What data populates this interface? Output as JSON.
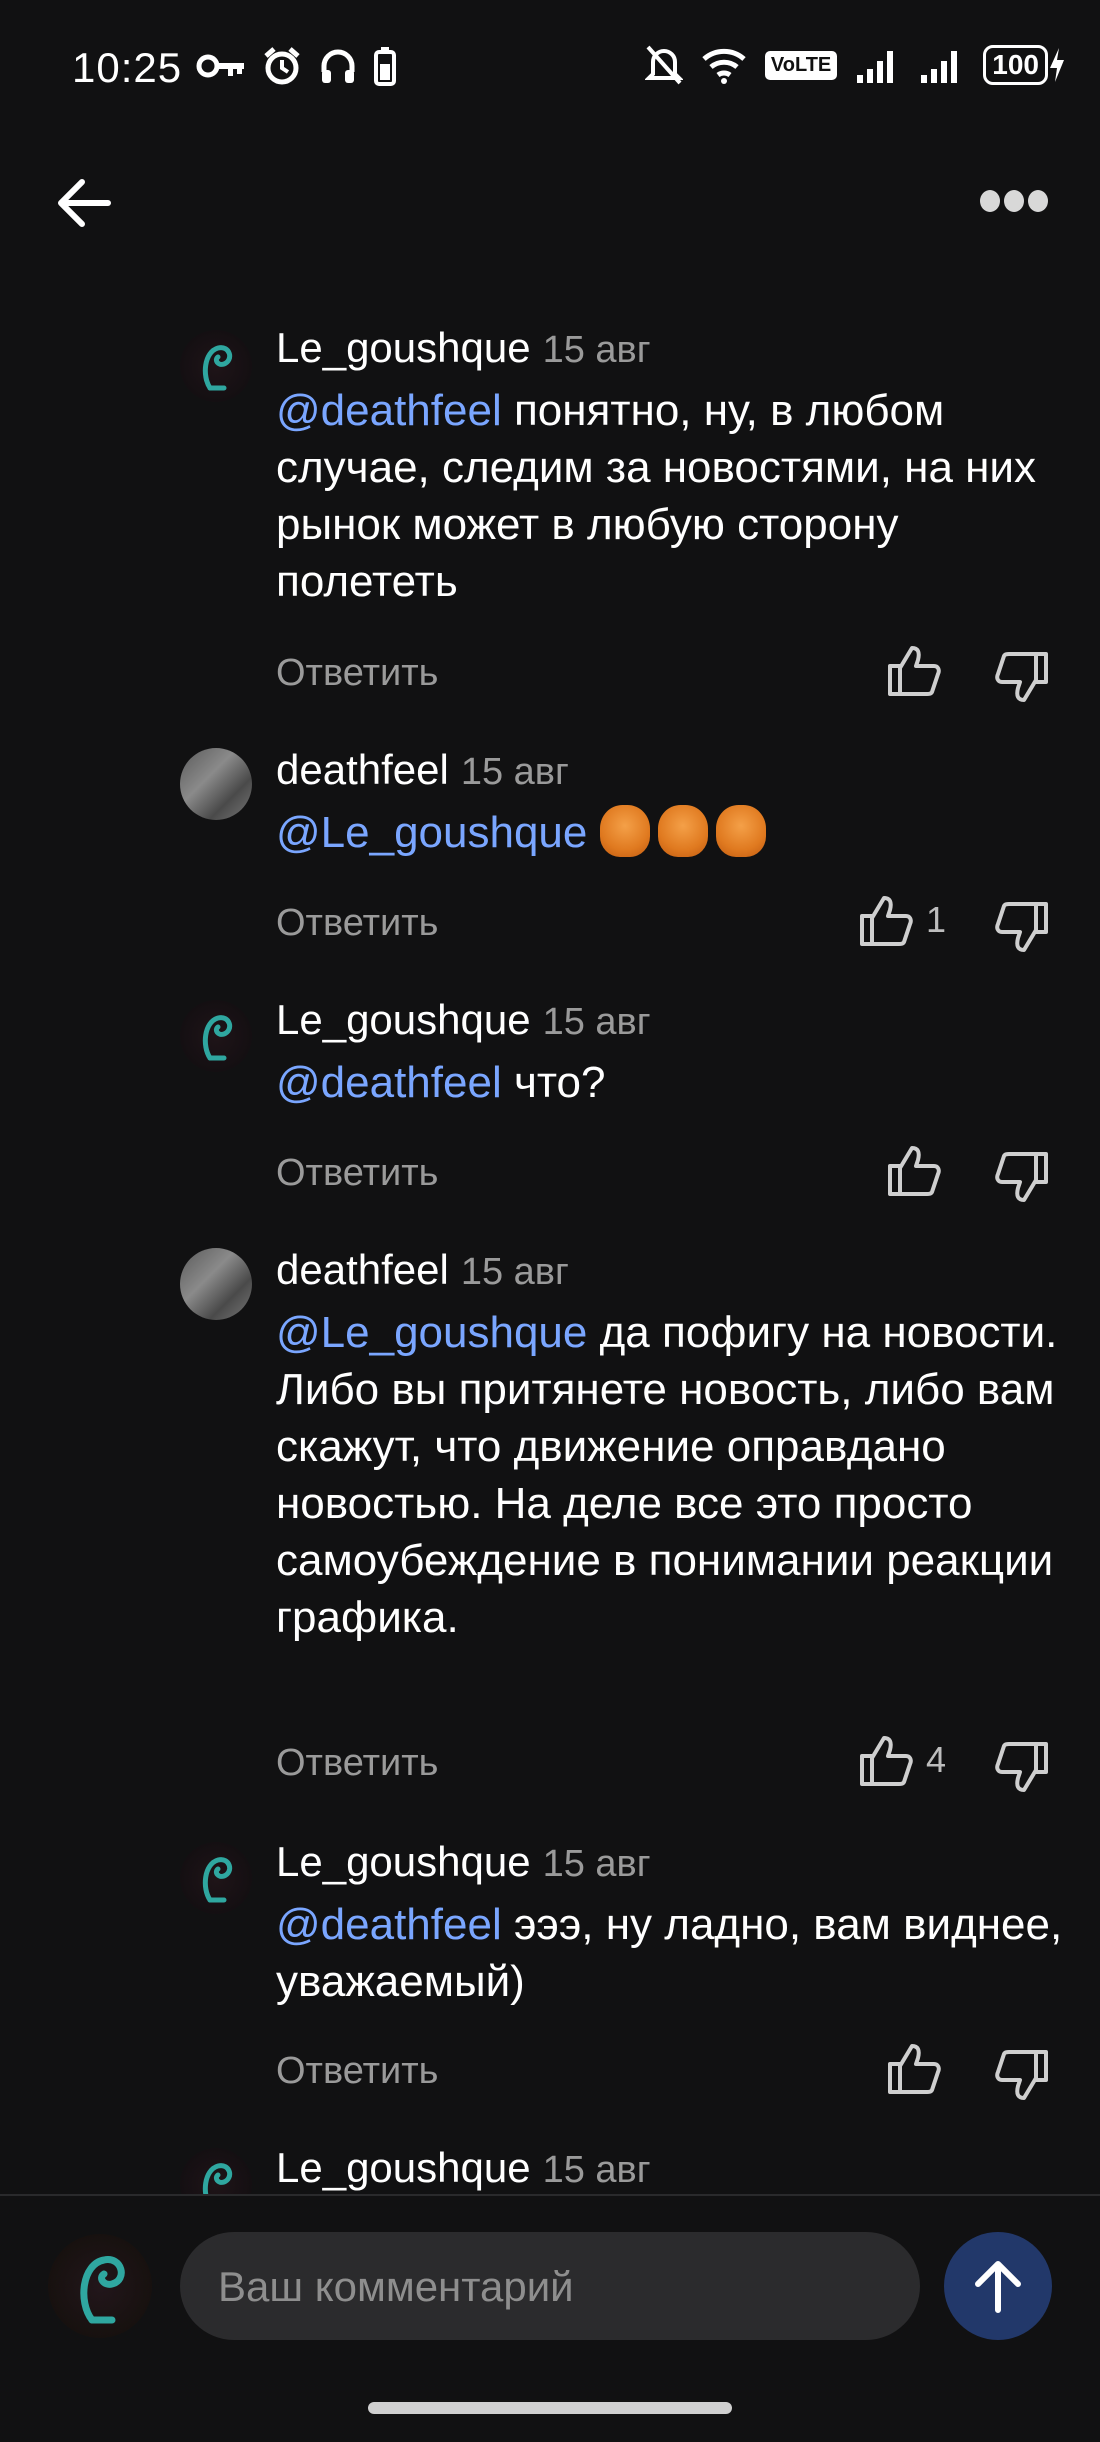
{
  "status_bar": {
    "time": "10:25",
    "volte": "VoLTE",
    "battery": "100"
  },
  "comments": [
    {
      "author": "Le_goushque",
      "date": "15 авг",
      "mention": "@deathfeel",
      "text": " понятно, ну, в любом случае, следим за новостями, на них рынок может в любую сторону полететь",
      "reply": "Ответить",
      "likes": ""
    },
    {
      "author": "deathfeel",
      "date": "15 авг",
      "mention": "@Le_goushque",
      "text": "",
      "reply": "Ответить",
      "likes": "1"
    },
    {
      "author": "Le_goushque",
      "date": "15 авг",
      "mention": "@deathfeel",
      "text": " что?",
      "reply": "Ответить",
      "likes": ""
    },
    {
      "author": "deathfeel",
      "date": "15 авг",
      "mention": "@Le_goushque",
      "text": " да пофигу на новости. Либо вы притянете новость, либо вам скажут, что движение оправдано новостью. На деле все это просто самоубеждение в понимании реакции графика.",
      "reply": "Ответить",
      "likes": "4"
    },
    {
      "author": "Le_goushque",
      "date": "15 авг",
      "mention": "@deathfeel",
      "text": " эээ, ну ладно, вам виднее, уважаемый)",
      "reply": "Ответить",
      "likes": ""
    },
    {
      "author": "Le_goushque",
      "date": "15 авг"
    }
  ],
  "input": {
    "placeholder": "Ваш комментарий"
  },
  "icons": {
    "back": "arrow-left-icon",
    "more": "more-dots-icon",
    "like": "thumbs-up-icon",
    "dislike": "thumbs-down-icon",
    "send": "arrow-up-icon"
  },
  "colors": {
    "background": "#111112",
    "mention": "#7aa6ff",
    "send_button": "#22386a",
    "input_bg": "#2b2b2d"
  }
}
